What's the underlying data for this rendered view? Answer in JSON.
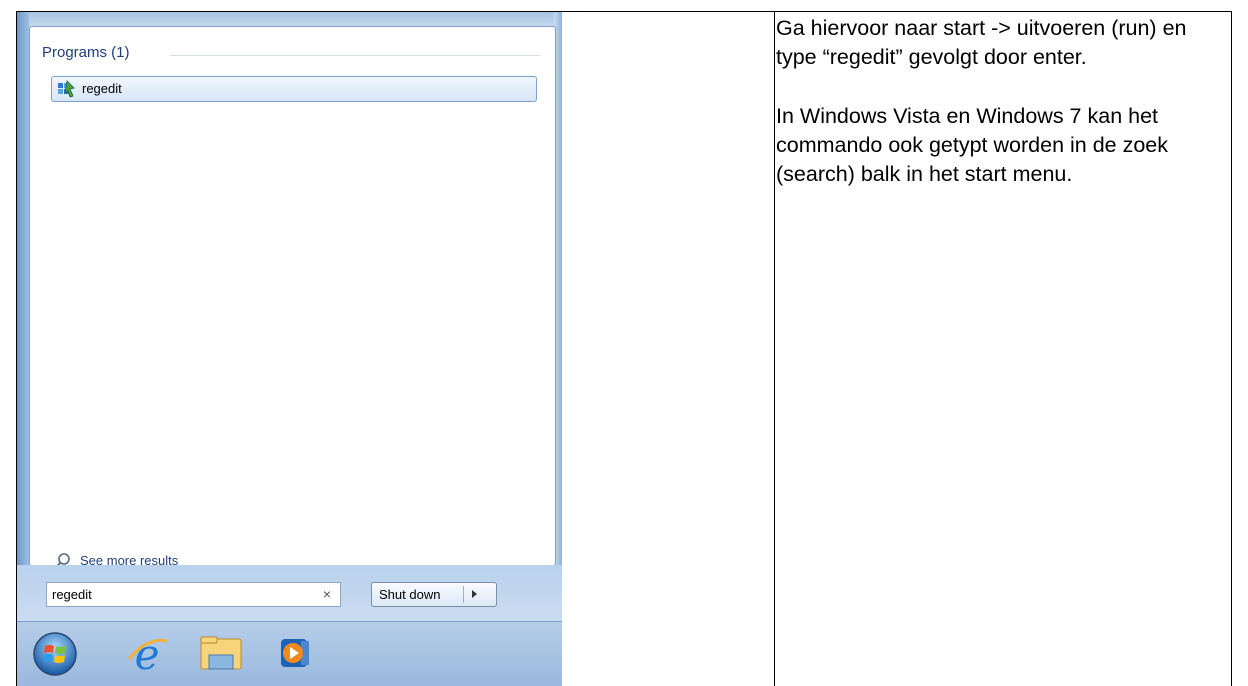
{
  "start_menu": {
    "section_title": "Programs (1)",
    "results": [
      {
        "label": "regedit",
        "icon": "regedit-icon"
      }
    ],
    "see_more_label": "See more results",
    "search": {
      "value": "regedit",
      "clear_glyph": "×"
    },
    "shutdown_label": "Shut down"
  },
  "taskbar": {
    "items": [
      "start-orb-icon",
      "internet-explorer-icon",
      "windows-explorer-icon",
      "media-player-icon"
    ]
  },
  "instructions": {
    "paragraph1": "Ga hiervoor naar start -> uitvoeren (run) en type “regedit” gevolgt door enter.",
    "paragraph2": "In Windows Vista en Windows 7 kan het commando ook getypt worden in de zoek (search) balk in het start menu."
  },
  "colors": {
    "selection_blue": "#d6e6f9",
    "taskbar_blue": "#9ab8dd",
    "heading_blue": "#1e3f7c"
  }
}
